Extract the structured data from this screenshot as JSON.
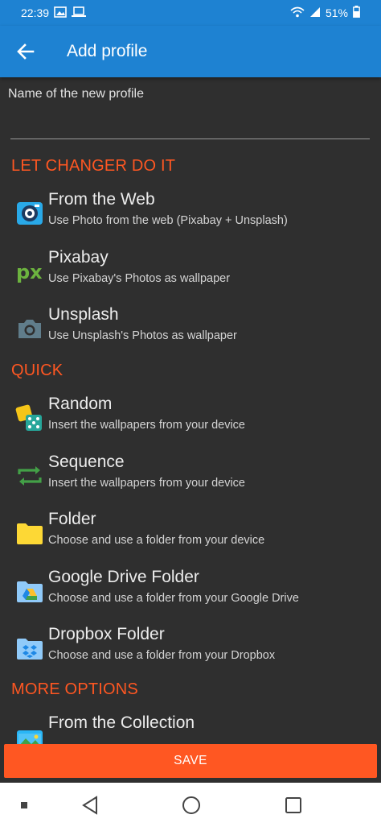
{
  "status_bar": {
    "time": "22:39",
    "battery": "51%"
  },
  "app_bar": {
    "title": "Add profile"
  },
  "name_field": {
    "label": "Name of the new profile",
    "value": ""
  },
  "sections": {
    "let_changer": "LET CHANGER DO IT",
    "quick": "QUICK",
    "more_options": "MORE OPTIONS"
  },
  "items": [
    {
      "title": "From the Web",
      "subtitle": "Use Photo from the web (Pixabay + Unsplash)",
      "icon": "web-camera-icon"
    },
    {
      "title": "Pixabay",
      "subtitle": "Use Pixabay's Photos as wallpaper",
      "icon": "pixabay-icon"
    },
    {
      "title": "Unsplash",
      "subtitle": "Use Unsplash's Photos as wallpaper",
      "icon": "camera-icon"
    },
    {
      "title": "Random",
      "subtitle": "Insert the wallpapers from your device",
      "icon": "dice-icon"
    },
    {
      "title": "Sequence",
      "subtitle": "Insert the wallpapers from your device",
      "icon": "repeat-icon"
    },
    {
      "title": "Folder",
      "subtitle": "Choose and use a folder from your device",
      "icon": "folder-icon"
    },
    {
      "title": "Google Drive Folder",
      "subtitle": "Choose and use a folder from your Google Drive",
      "icon": "google-drive-folder-icon"
    },
    {
      "title": "Dropbox Folder",
      "subtitle": "Choose and use a folder from your Dropbox",
      "icon": "dropbox-folder-icon"
    },
    {
      "title": "From the Collection",
      "subtitle": "",
      "icon": "collection-icon"
    }
  ],
  "save_button": {
    "label": "SAVE"
  },
  "colors": {
    "app_bar": "#1e82d2",
    "accent": "#ff5722",
    "background": "#2f2f2f"
  }
}
